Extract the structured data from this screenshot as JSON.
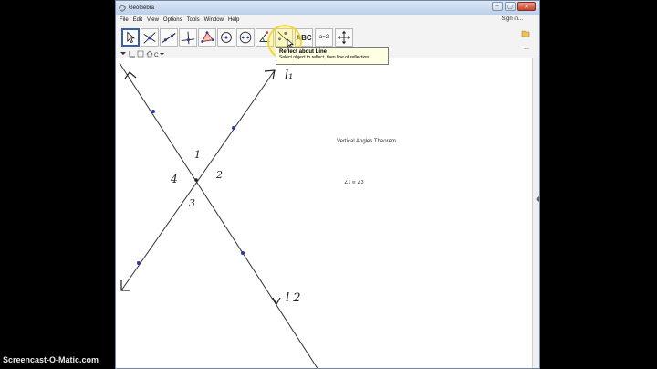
{
  "window": {
    "title": "GeoGebra",
    "controls": [
      "–",
      "▢",
      "✕"
    ]
  },
  "menubar": {
    "items": [
      "File",
      "Edit",
      "View",
      "Options",
      "Tools",
      "Window",
      "Help"
    ],
    "sign_in": "Sign in..."
  },
  "toolbar": {
    "tools": [
      {
        "name": "move-tool",
        "icon": "arrow-pointer-icon"
      },
      {
        "name": "point-tool",
        "icon": "point-icon"
      },
      {
        "name": "line-tool",
        "icon": "line-icon"
      },
      {
        "name": "perpendicular-tool",
        "icon": "perpendicular-line-icon"
      },
      {
        "name": "polygon-tool",
        "icon": "triangle-icon"
      },
      {
        "name": "circle-tool",
        "icon": "circle-icon"
      },
      {
        "name": "ellipse-tool",
        "icon": "ellipse-icon"
      },
      {
        "name": "angle-tool",
        "icon": "angle-icon"
      },
      {
        "name": "reflect-tool",
        "icon": "reflect-line-icon"
      },
      {
        "name": "text-tool",
        "icon": "abc-text-icon",
        "label": "ABC"
      },
      {
        "name": "slider-tool",
        "icon": "slider-icon",
        "label": "a=2"
      },
      {
        "name": "move-view-tool",
        "icon": "move-graphics-icon"
      }
    ],
    "selected": "move-tool"
  },
  "tooltip": {
    "title": "Reflect about Line",
    "description": "Select object to reflect, then line of reflection"
  },
  "graphics": {
    "title_text": "Vertical Angles Theorem",
    "equation": "∠1 ≅ ∠3",
    "handwritten_labels": {
      "l1": "l₁",
      "l2": "l 2",
      "angle1": "1",
      "angle2": "2",
      "angle3": "3",
      "angle4": "4"
    }
  },
  "watermark": "Screencast-O-Matic.com",
  "colors": {
    "window_frame": "#c9d9ec",
    "selected_tool": "#3b5fa8",
    "tooltip_bg": "#ffffe1",
    "point": "#2a3ca0",
    "line": "#333333"
  }
}
